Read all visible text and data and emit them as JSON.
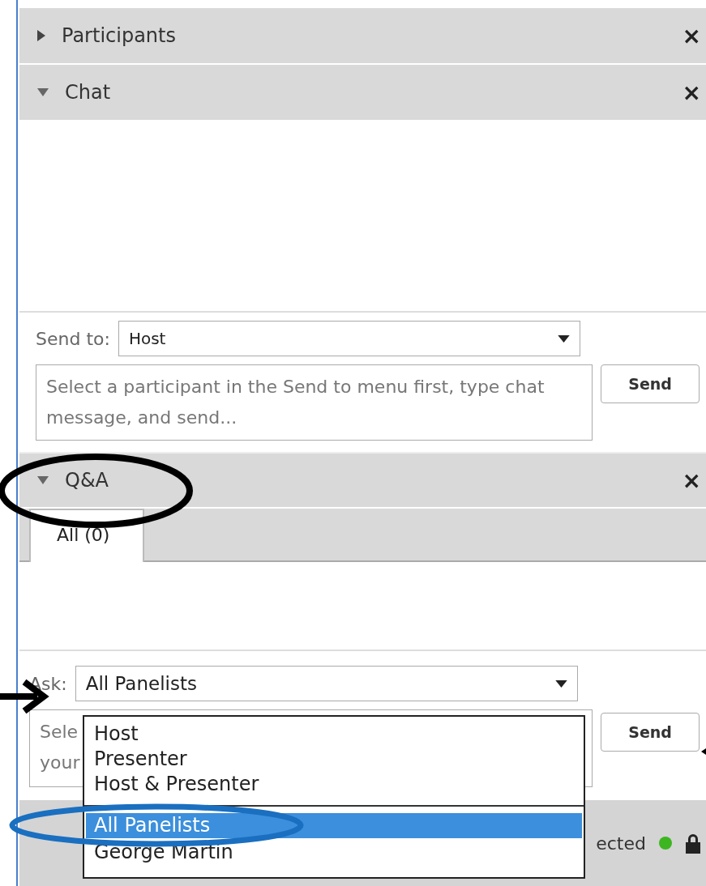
{
  "participants_panel": {
    "title": "Participants",
    "expanded": false,
    "close": "×"
  },
  "chat_panel": {
    "title": "Chat",
    "expanded": true,
    "close": "×",
    "send_to_label": "Send to:",
    "send_to_value": "Host",
    "message_placeholder": "Select a participant in the Send to menu first, type chat message, and send...",
    "send_button": "Send"
  },
  "qa_panel": {
    "title": "Q&A",
    "expanded": true,
    "close": "×",
    "tabs": [
      {
        "label": "All (0)",
        "selected": true
      }
    ],
    "ask_label": "Ask:",
    "ask_value": "All Panelists",
    "question_lines": [
      "Sele",
      "your"
    ],
    "send_button": "Send",
    "ask_menu": [
      {
        "kind": "option",
        "label": "Host",
        "selected": false
      },
      {
        "kind": "option",
        "label": "Presenter",
        "selected": false
      },
      {
        "kind": "option",
        "label": "Host & Presenter",
        "selected": false
      },
      {
        "kind": "separator"
      },
      {
        "kind": "option",
        "label": "All Panelists",
        "selected": true
      },
      {
        "kind": "option",
        "label": "George Martin",
        "selected": false
      }
    ]
  },
  "status_bar": {
    "text": "ected"
  }
}
